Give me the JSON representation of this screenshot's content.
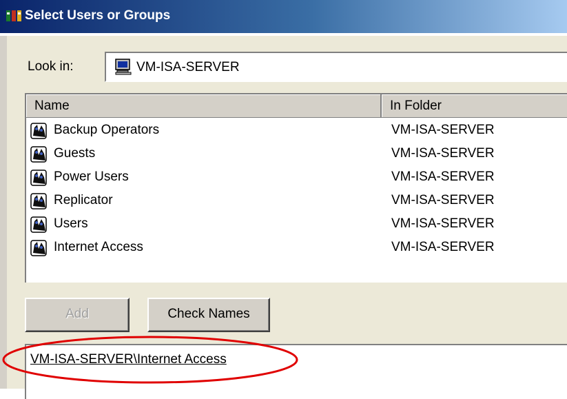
{
  "window": {
    "title": "Select Users or Groups",
    "title_gradient_start": "#0a246a",
    "title_gradient_end": "#a6caf0",
    "title_icon": "users-groups-icon"
  },
  "look_in": {
    "label": "Look in:",
    "value": "VM-ISA-SERVER",
    "icon": "computer-icon"
  },
  "list": {
    "columns": [
      "Name",
      "In Folder"
    ],
    "rows": [
      {
        "name": "Backup Operators",
        "folder": "VM-ISA-SERVER",
        "icon": "group-icon"
      },
      {
        "name": "Guests",
        "folder": "VM-ISA-SERVER",
        "icon": "group-icon"
      },
      {
        "name": "Power Users",
        "folder": "VM-ISA-SERVER",
        "icon": "group-icon"
      },
      {
        "name": "Replicator",
        "folder": "VM-ISA-SERVER",
        "icon": "group-icon"
      },
      {
        "name": "Users",
        "folder": "VM-ISA-SERVER",
        "icon": "group-icon"
      },
      {
        "name": "Internet Access",
        "folder": "VM-ISA-SERVER",
        "icon": "group-icon"
      }
    ]
  },
  "buttons": {
    "add": "Add",
    "check_names": "Check Names"
  },
  "selected_names": {
    "value": "VM-ISA-SERVER\\Internet Access",
    "annotation_color": "#e00000"
  }
}
